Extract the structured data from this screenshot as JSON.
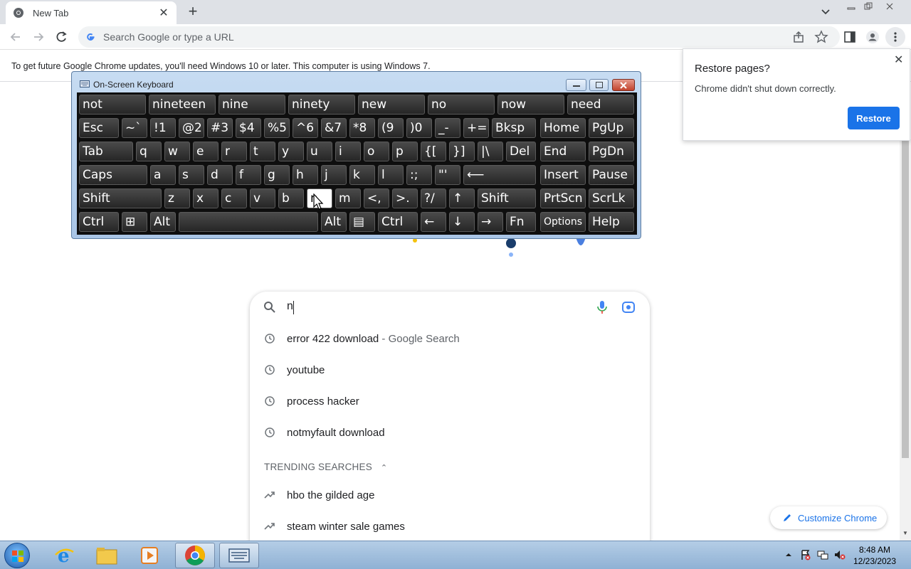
{
  "browser": {
    "tab_title": "New Tab",
    "omnibox_placeholder": "Search Google or type a URL",
    "info_message": "To get future Google Chrome updates, you'll need Windows 10 or later. This computer is using Windows 7."
  },
  "restore_popup": {
    "title": "Restore pages?",
    "message": "Chrome didn't shut down correctly.",
    "button": "Restore"
  },
  "search": {
    "typed_text": "n",
    "suggestions": [
      {
        "text": "error 422 download",
        "hint": " - Google Search",
        "icon": "history-icon"
      },
      {
        "text": "youtube",
        "hint": "",
        "icon": "history-icon"
      },
      {
        "text": "process hacker",
        "hint": "",
        "icon": "history-icon"
      },
      {
        "text": "notmyfault download",
        "hint": "",
        "icon": "history-icon"
      }
    ],
    "trending_header": "TRENDING SEARCHES",
    "trending": [
      {
        "text": "hbo the gilded age",
        "icon": "trending-icon"
      },
      {
        "text": "steam winter sale games",
        "icon": "trending-icon"
      }
    ]
  },
  "customize_label": "Customize Chrome",
  "osk": {
    "title": "On-Screen Keyboard",
    "predictions": [
      "not",
      "nineteen",
      "nine",
      "ninety",
      "new",
      "no",
      "now",
      "need"
    ],
    "row1": [
      "Esc",
      "~`",
      "!1",
      "@2",
      "#3",
      "$4",
      "%5",
      "^6",
      "&7",
      "*8",
      "(9",
      ")0",
      "_-",
      "+=",
      "Bksp",
      "Home",
      "PgUp"
    ],
    "row2": [
      "Tab",
      "q",
      "w",
      "e",
      "r",
      "t",
      "y",
      "u",
      "i",
      "o",
      "p",
      "{[",
      "}]",
      "|\\",
      "Del",
      "End",
      "PgDn"
    ],
    "row3": [
      "Caps",
      "a",
      "s",
      "d",
      "f",
      "g",
      "h",
      "j",
      "k",
      "l",
      ":;",
      "\"'",
      "⟵",
      "Insert",
      "Pause"
    ],
    "row4": [
      "Shift",
      "z",
      "x",
      "c",
      "v",
      "b",
      "n",
      "m",
      "<,",
      ">.",
      "?/",
      "↑",
      "Shift",
      "PrtScn",
      "ScrLk"
    ],
    "row5": [
      "Ctrl",
      "⊞",
      "Alt",
      "",
      "Alt",
      "▤",
      "Ctrl",
      "←",
      "↓",
      "→",
      "Fn",
      "Options",
      "Help"
    ],
    "pressed_key": "n"
  },
  "taskbar": {
    "time": "8:48 AM",
    "date": "12/23/2023"
  }
}
